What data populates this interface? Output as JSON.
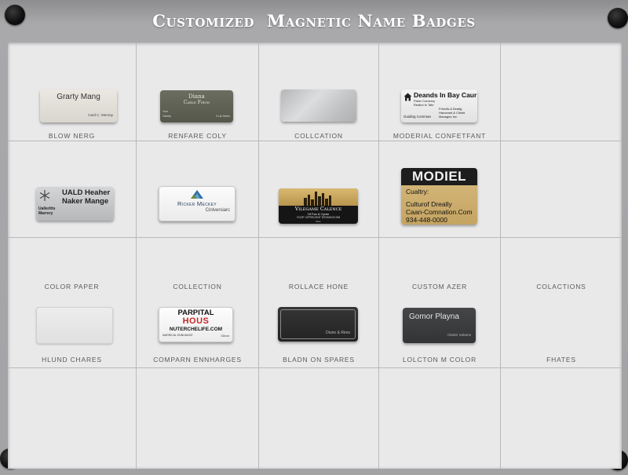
{
  "title": "Customized  Magnetic Name Badges",
  "cells": [
    {
      "label": "BLOW NERG",
      "badge": {
        "name": "Grarty Mang",
        "sub": "Card C. Mernay"
      }
    },
    {
      "label": "RENFARE COLY",
      "badge": {
        "name": "Diana",
        "title": "Carle Firon",
        "left1": "Your",
        "left2": "Clarlity",
        "right": "3 Lla Streer"
      }
    },
    {
      "label": "COLLCATION",
      "badge": {}
    },
    {
      "label": "MODERIAL CONFETFANT",
      "badge": {
        "name": "Deands In Bay Caur",
        "line1": "Fister Comercy",
        "line2": "Realtoi In Tahr",
        "line3": "Frirndls A Dealtg",
        "line4": "Hanceant & Citrals",
        "line5": "Manages Inc.",
        "left": "Guiding Comman"
      }
    },
    {
      "label": "COLOR PAPER",
      "badge": {
        "line1": "UALD Heaher",
        "line2": "Naker Mange",
        "small1": "Ualleritts",
        "small2": "Marrery"
      }
    },
    {
      "label": "COLLECTION",
      "badge": {
        "name": "Ricker Meckey",
        "sub": "Cinlversiarc"
      }
    },
    {
      "label": "ROLLACE HONE",
      "badge": {
        "name": "Vilegame Calence",
        "line1": "Of Fax & Cyree",
        "line2": "Yoof Ciprscent Ervasigcom",
        "line3": "Bele"
      }
    },
    {
      "label": "CUSTOM AZER",
      "badge": {
        "header": "MODIEL",
        "line1": "Cualtry:",
        "line2": "Culturof Dreally",
        "line3": "Caan-Comnation.Com",
        "line4": "934-448-0000"
      }
    },
    {
      "label": "COLACTIONS",
      "badge": null
    },
    {
      "label": "HLUND CHARES",
      "badge": {}
    },
    {
      "label": "COMPARN ENNHARGES",
      "badge": {
        "line1": "PARPITAL",
        "line2": "HOUS",
        "line3": "NUTERCHELIFE.COM",
        "line4": "Marrical Ennhance",
        "right": "Clinor"
      }
    },
    {
      "label": "BLADN ON SPARES",
      "badge": {
        "right": "Diune & Rires"
      }
    },
    {
      "label": "LOLCTON M COLOR",
      "badge": {
        "name": "Gomor Playna",
        "sub": "Clarter Solarns"
      }
    },
    {
      "label": "FHATES",
      "badge": null
    }
  ],
  "colors": {
    "board": "#a3a3a6",
    "panel": "#e9e9ea",
    "silver": "#c8c9cb",
    "olive": "#5c5e51",
    "gold": "#caa968",
    "black": "#2b2b2c",
    "charcoal": "#3a3b3d",
    "red": "#c62828"
  }
}
